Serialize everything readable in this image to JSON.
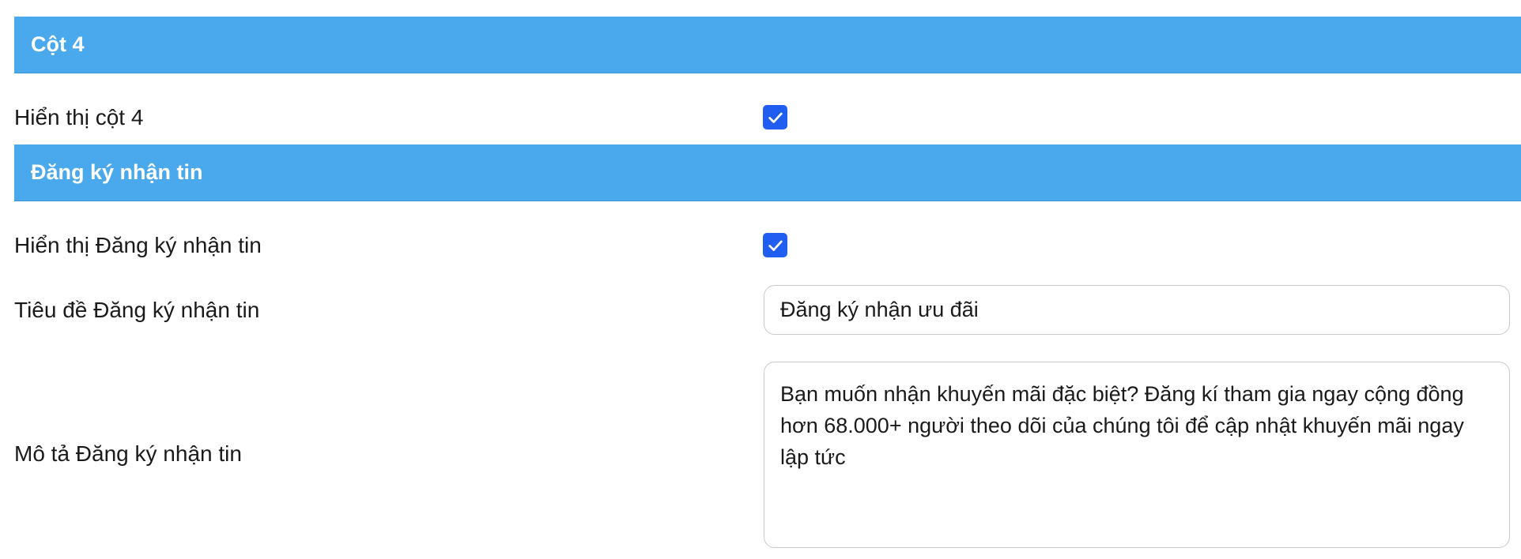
{
  "sections": {
    "column4": {
      "title": "Cột 4",
      "show_label": "Hiển thị cột 4",
      "show_checked": true
    },
    "newsletter": {
      "title": "Đăng ký nhận tin",
      "show_label": "Hiển thị Đăng ký nhận tin",
      "show_checked": true,
      "title_label": "Tiêu đề Đăng ký nhận tin",
      "title_value": "Đăng ký nhận ưu đãi",
      "description_label": "Mô tả Đăng ký nhận tin",
      "description_value": "Bạn muốn nhận khuyến mãi đặc biệt? Đăng kí tham gia ngay cộng đồng hơn 68.000+ người theo dõi của chúng tôi để cập nhật khuyến mãi ngay lập tức"
    }
  },
  "colors": {
    "header_bg": "#4aa9ec",
    "checkbox_bg": "#1f5ef0"
  },
  "icons": {
    "checkbox_mark": "checkmark-icon"
  }
}
